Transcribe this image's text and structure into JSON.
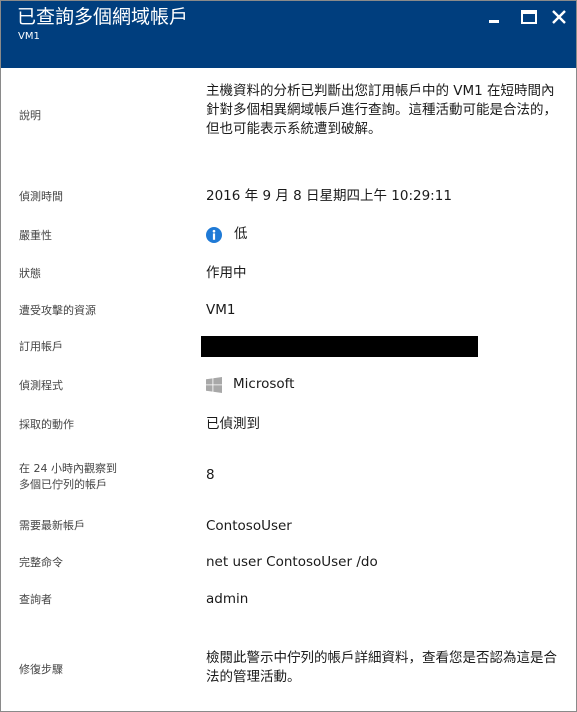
{
  "header": {
    "title": "已查詢多個網域帳戶",
    "subtitle": "VM1"
  },
  "colors": {
    "header_bg": "#003e7e",
    "info_icon": "#1f7ad6",
    "ms_logo": "#a8a8a8"
  },
  "window_controls": [
    "minimize-icon",
    "maximize-icon",
    "close-icon"
  ],
  "details": {
    "description": {
      "label": "說明",
      "value": "主機資料的分析已判斷出您訂用帳戶中的 VM1 在短時間內針對多個相異網域帳戶進行查詢。這種活動可能是合法的，但也可能表示系統遭到破解。"
    },
    "detection_time": {
      "label": "偵測時間",
      "value": "2016 年 9 月 8 日星期四上午 10:29:11"
    },
    "severity": {
      "label": "嚴重性",
      "value": "低",
      "icon": "info-icon"
    },
    "state": {
      "label": "狀態",
      "value": "作用中"
    },
    "attacked_resource": {
      "label": "遭受攻擊的資源",
      "value": "VM1"
    },
    "subscription": {
      "label": "訂用帳戶",
      "value_redacted": true
    },
    "detected_by": {
      "label": "偵測程式",
      "value": "Microsoft",
      "icon": "windows-logo-icon"
    },
    "action_taken": {
      "label": "採取的動作",
      "value": "已偵測到"
    },
    "accounts_enumerated": {
      "label_line1": "在 24 小時內觀察到",
      "label_line2": "多個已佇列的帳戶",
      "value": "8"
    },
    "latest_account": {
      "label": "需要最新帳戶",
      "value": "ContosoUser"
    },
    "command_line": {
      "label": "完整命令",
      "value": "net user ContosoUser /do"
    },
    "queried_by": {
      "label": "查詢者",
      "value": "admin"
    },
    "remediation": {
      "label": "修復步驟",
      "value": "檢閱此警示中佇列的帳戶詳細資料，查看您是否認為這是合法的管理活動。"
    }
  }
}
